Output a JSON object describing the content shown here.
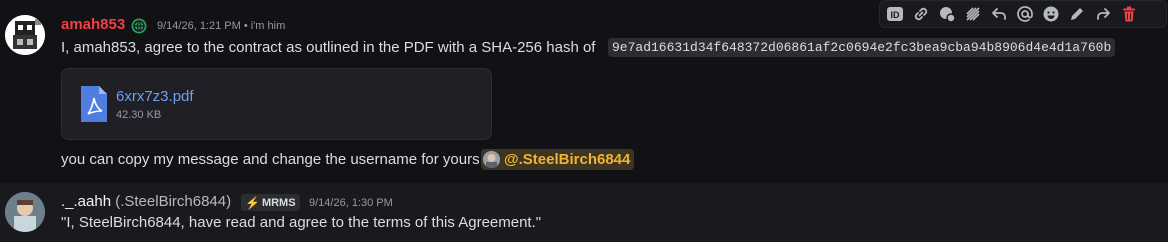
{
  "messages": [
    {
      "username": "amah853",
      "timestamp": "9/14/26, 1:21 PM • i'm him",
      "text": "I, amah853, agree to the contract as outlined in the PDF with a SHA-256 hash of",
      "hash": "9e7ad16631d34f648372d06861af2c0694e2fc3bea9cba94b8906d4e4d1a760b",
      "attachment": {
        "name": "6xrx7z3.pdf",
        "size": "42.30 KB",
        "icon": "pdf-file-icon"
      },
      "followup": "you can copy my message and change the username for yours",
      "mention": "@.SteelBirch6844"
    },
    {
      "username": "._.aahh",
      "nick": "(.SteelBirch6844)",
      "tag": "MRMS",
      "timestamp": "9/14/26, 1:30 PM",
      "text": "\"I, SteelBirch6844, have read and agree to the terms of this Agreement.\""
    }
  ],
  "toolbar": {
    "icons": [
      "id-icon",
      "link-icon",
      "thread-icon",
      "skip-icon",
      "reply-icon",
      "mention-icon",
      "emoji-icon",
      "edit-icon",
      "forward-icon",
      "delete-icon"
    ]
  },
  "colors": {
    "username_red": "#f23f43",
    "mention_yellow": "#f0b232",
    "link_blue": "#6fa0ee",
    "delete_red": "#f23f43"
  }
}
